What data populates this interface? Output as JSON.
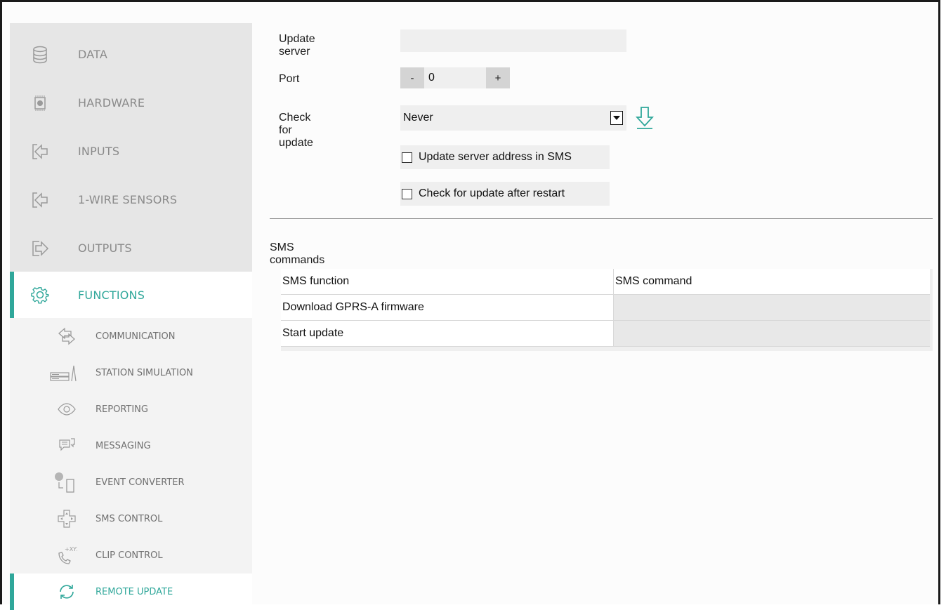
{
  "sidebar": {
    "main_items": [
      {
        "label": "DATA",
        "icon": "database-icon"
      },
      {
        "label": "HARDWARE",
        "icon": "chip-icon"
      },
      {
        "label": "INPUTS",
        "icon": "input-arrow-icon"
      },
      {
        "label": "1-WIRE SENSORS",
        "icon": "input-arrow-icon"
      },
      {
        "label": "OUTPUTS",
        "icon": "output-arrow-icon"
      },
      {
        "label": "FUNCTIONS",
        "icon": "gear-icon"
      }
    ],
    "sub_items": [
      {
        "label": "COMMUNICATION",
        "icon": "arrows-exchange-icon"
      },
      {
        "label": "STATION SIMULATION",
        "icon": "server-icon"
      },
      {
        "label": "REPORTING",
        "icon": "eye-icon"
      },
      {
        "label": "MESSAGING",
        "icon": "message-icon"
      },
      {
        "label": "EVENT CONVERTER",
        "icon": "converter-icon"
      },
      {
        "label": "SMS CONTROL",
        "icon": "dpad-icon"
      },
      {
        "label": "CLIP CONTROL",
        "icon": "phone-icon"
      },
      {
        "label": "REMOTE UPDATE",
        "icon": "sync-icon"
      }
    ],
    "accent_color": "#2fa79a"
  },
  "form": {
    "update_server_label": "Update server",
    "update_server_value": "",
    "port_label": "Port",
    "port_minus": "-",
    "port_value": "0",
    "port_plus": "+",
    "check_update_label": "Check for update",
    "check_update_value": "Never",
    "checkbox_sms_label": "Update server address in SMS",
    "checkbox_sms_checked": false,
    "checkbox_restart_label": "Check for update after restart",
    "checkbox_restart_checked": false
  },
  "sms": {
    "section_title": "SMS commands",
    "columns": [
      "SMS function",
      "SMS command"
    ],
    "rows": [
      {
        "function": "Download GPRS-A firmware",
        "command": ""
      },
      {
        "function": "Start update",
        "command": ""
      }
    ]
  }
}
